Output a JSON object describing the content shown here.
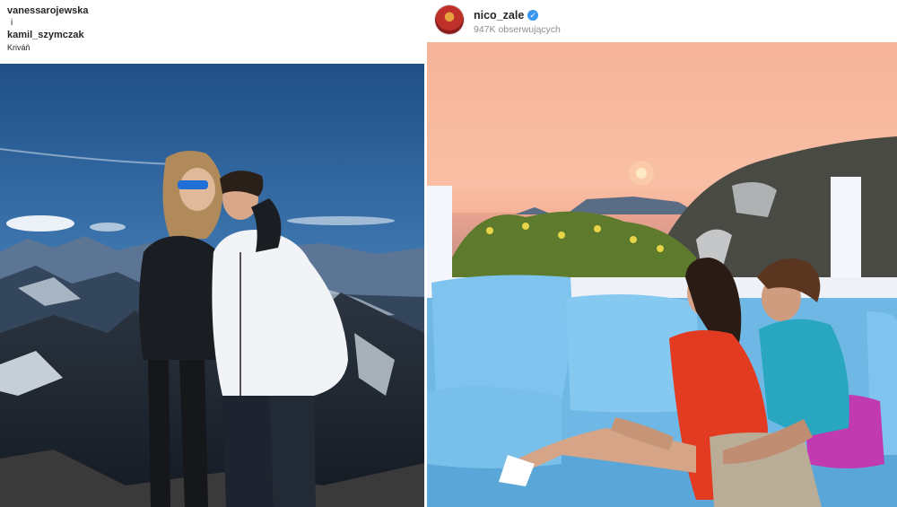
{
  "left_post": {
    "user_primary": "vanessarojewska",
    "separator": "i",
    "user_secondary": "kamil_szymczak",
    "location": "Kriváň",
    "photo_icon": "photo-mountain-summit"
  },
  "right_post": {
    "username": "nico_zale",
    "verified_icon": "verified-badge-icon",
    "followers": "947K obserwujących",
    "photo_icon": "photo-sunset-terrace"
  },
  "colors": {
    "verified": "#3897f0",
    "text_primary": "#262626",
    "text_secondary": "#8e8e8e"
  }
}
